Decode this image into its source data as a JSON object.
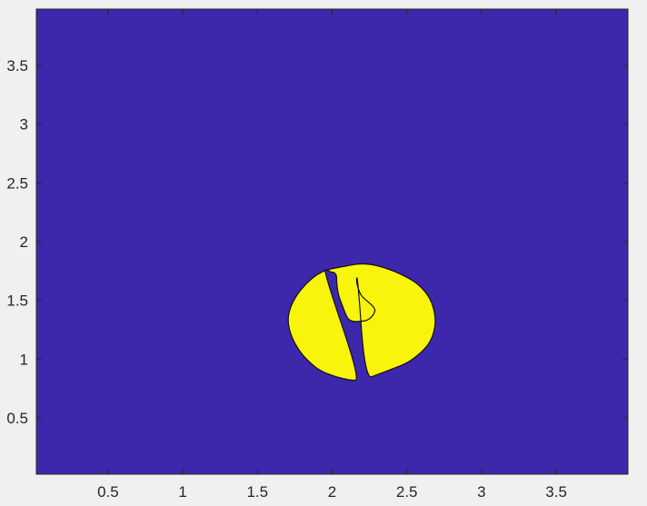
{
  "chart_data": {
    "type": "contour",
    "title": "",
    "xlabel": "",
    "ylabel": "",
    "xlim": [
      0.02,
      3.98
    ],
    "ylim": [
      0.02,
      3.98
    ],
    "xticks": [
      0.5,
      1,
      1.5,
      2,
      2.5,
      3,
      3.5
    ],
    "xtick_labels": [
      "0.5",
      "1",
      "1.5",
      "2",
      "2.5",
      "3",
      "3.5"
    ],
    "yticks": [
      0.5,
      1,
      1.5,
      2,
      2.5,
      3,
      3.5
    ],
    "ytick_labels": [
      "0.5",
      "1",
      "1.5",
      "2",
      "2.5",
      "3",
      "3.5"
    ],
    "grid": false,
    "background_color": "#3d28ab",
    "region_color": "#f8f40c",
    "outline_color": "#111111",
    "region": {
      "x": [
        2.19,
        2.12,
        2.02,
        1.92,
        1.86,
        1.79,
        1.73,
        1.7,
        1.72,
        1.79,
        1.92,
        2.08,
        2.22,
        2.38,
        2.53,
        2.6,
        2.66,
        2.69,
        2.69,
        2.66,
        2.6,
        2.51,
        2.41,
        2.31,
        2.22,
        2.17,
        2.16,
        2.19,
        2.24,
        2.29,
        2.28,
        2.24,
        2.19,
        2.13,
        2.1,
        2.07,
        2.04,
        2.03,
        2.03,
        2.02,
        2.01,
        1.99,
        1.97,
        1.94
      ],
      "y": [
        0.82,
        0.82,
        0.85,
        0.9,
        0.96,
        1.05,
        1.18,
        1.32,
        1.45,
        1.6,
        1.75,
        1.79,
        1.82,
        1.77,
        1.68,
        1.61,
        1.51,
        1.38,
        1.27,
        1.15,
        1.06,
        0.97,
        0.92,
        0.87,
        0.83,
        1.72,
        1.66,
        1.54,
        1.49,
        1.43,
        1.38,
        1.33,
        1.32,
        1.32,
        1.35,
        1.45,
        1.55,
        1.66,
        1.71,
        1.73,
        1.74,
        1.74,
        1.76,
        1.76
      ]
    }
  }
}
